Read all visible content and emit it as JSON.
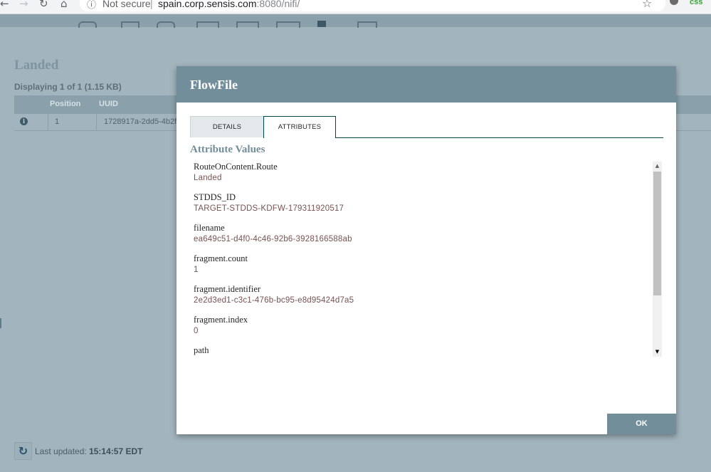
{
  "browser": {
    "back_glyph": "←",
    "forward_glyph": "→",
    "reload_glyph": "↻",
    "home_glyph": "⌂",
    "info_glyph": "ⓘ",
    "security_label": "Not secure",
    "separator": "|",
    "url_host": "spain.corp.sensis.com",
    "url_path": ":8080/nifi/",
    "star_glyph": "☆",
    "extension_label": "css"
  },
  "page": {
    "title": "Landed",
    "displaying": "Displaying 1 of 1 (1.15 KB)",
    "columns": [
      "Position",
      "UUID"
    ],
    "row": {
      "info_glyph": "i",
      "position": "1",
      "uuid": "1728917a-2dd5-4b2f"
    },
    "refresh_glyph": "↻",
    "last_updated_label": "Last updated:",
    "last_updated_time": "15:14:57 EDT"
  },
  "dialog": {
    "title": "FlowFile",
    "tabs": [
      {
        "label": "DETAILS",
        "active": false
      },
      {
        "label": "ATTRIBUTES",
        "active": true
      }
    ],
    "section_title": "Attribute Values",
    "attributes": [
      {
        "name": "RouteOnContent.Route",
        "value": "Landed"
      },
      {
        "name": "STDDS_ID",
        "value": "TARGET-STDDS-KDFW-179311920517"
      },
      {
        "name": "filename",
        "value": "ea649c51-d4f0-4c46-92b6-3928166588ab"
      },
      {
        "name": "fragment.count",
        "value": "1"
      },
      {
        "name": "fragment.identifier",
        "value": "2e2d3ed1-c3c1-476b-bc95-e8d95424d7a5"
      },
      {
        "name": "fragment.index",
        "value": "0"
      },
      {
        "name": "path",
        "value": ""
      }
    ],
    "scroll_up_glyph": "▲",
    "scroll_down_glyph": "▼",
    "ok_label": "OK"
  },
  "colors": {
    "header": "#728e9b",
    "overlay": "#a2b4bd",
    "attribute_value": "#775351",
    "tab_border": "#004849"
  }
}
